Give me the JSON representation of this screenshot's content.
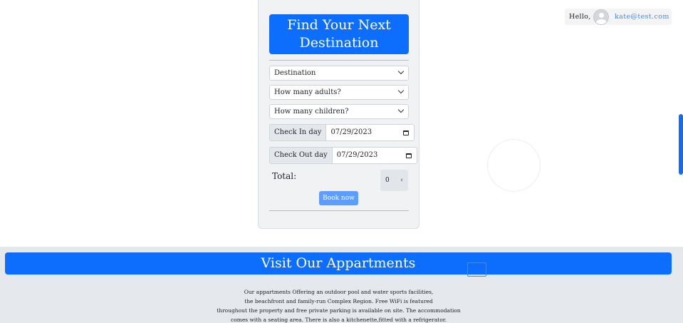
{
  "booking": {
    "title_line1": "Find Your Next",
    "title_line2": "Destination",
    "destination_select": "Destination",
    "adults_select": "How many adults?",
    "children_select": "How many children?",
    "checkin_label": "Check In day",
    "checkin_value": "07/29/2023",
    "checkout_label": "Check Out day",
    "checkout_value": "07/29/2023",
    "total_label": "Total:",
    "total_value": "0",
    "book_button": "Book now"
  },
  "user": {
    "greeting": "Hello,",
    "email": "kate@test.com",
    "avatar_icon": "user-avatar-icon"
  },
  "about": {
    "heading": "Visit Our Appartments",
    "lines": [
      "Our appartments Offering an outdoor pool and water sports facilities,",
      "the beachfront and family-run Complex Region. Free WiFi is featured",
      "throughout the property and free private parking is available on site. The accommodation",
      "comes with a seating area. There is also a kitchenette,fitted with a refrigerator."
    ]
  },
  "colors": {
    "primary": "#0d6efd",
    "button_light": "#5c9dfd",
    "email": "#3d8bfd",
    "card_bg": "#f1f2f4",
    "section_bg": "#e5e8ec"
  }
}
